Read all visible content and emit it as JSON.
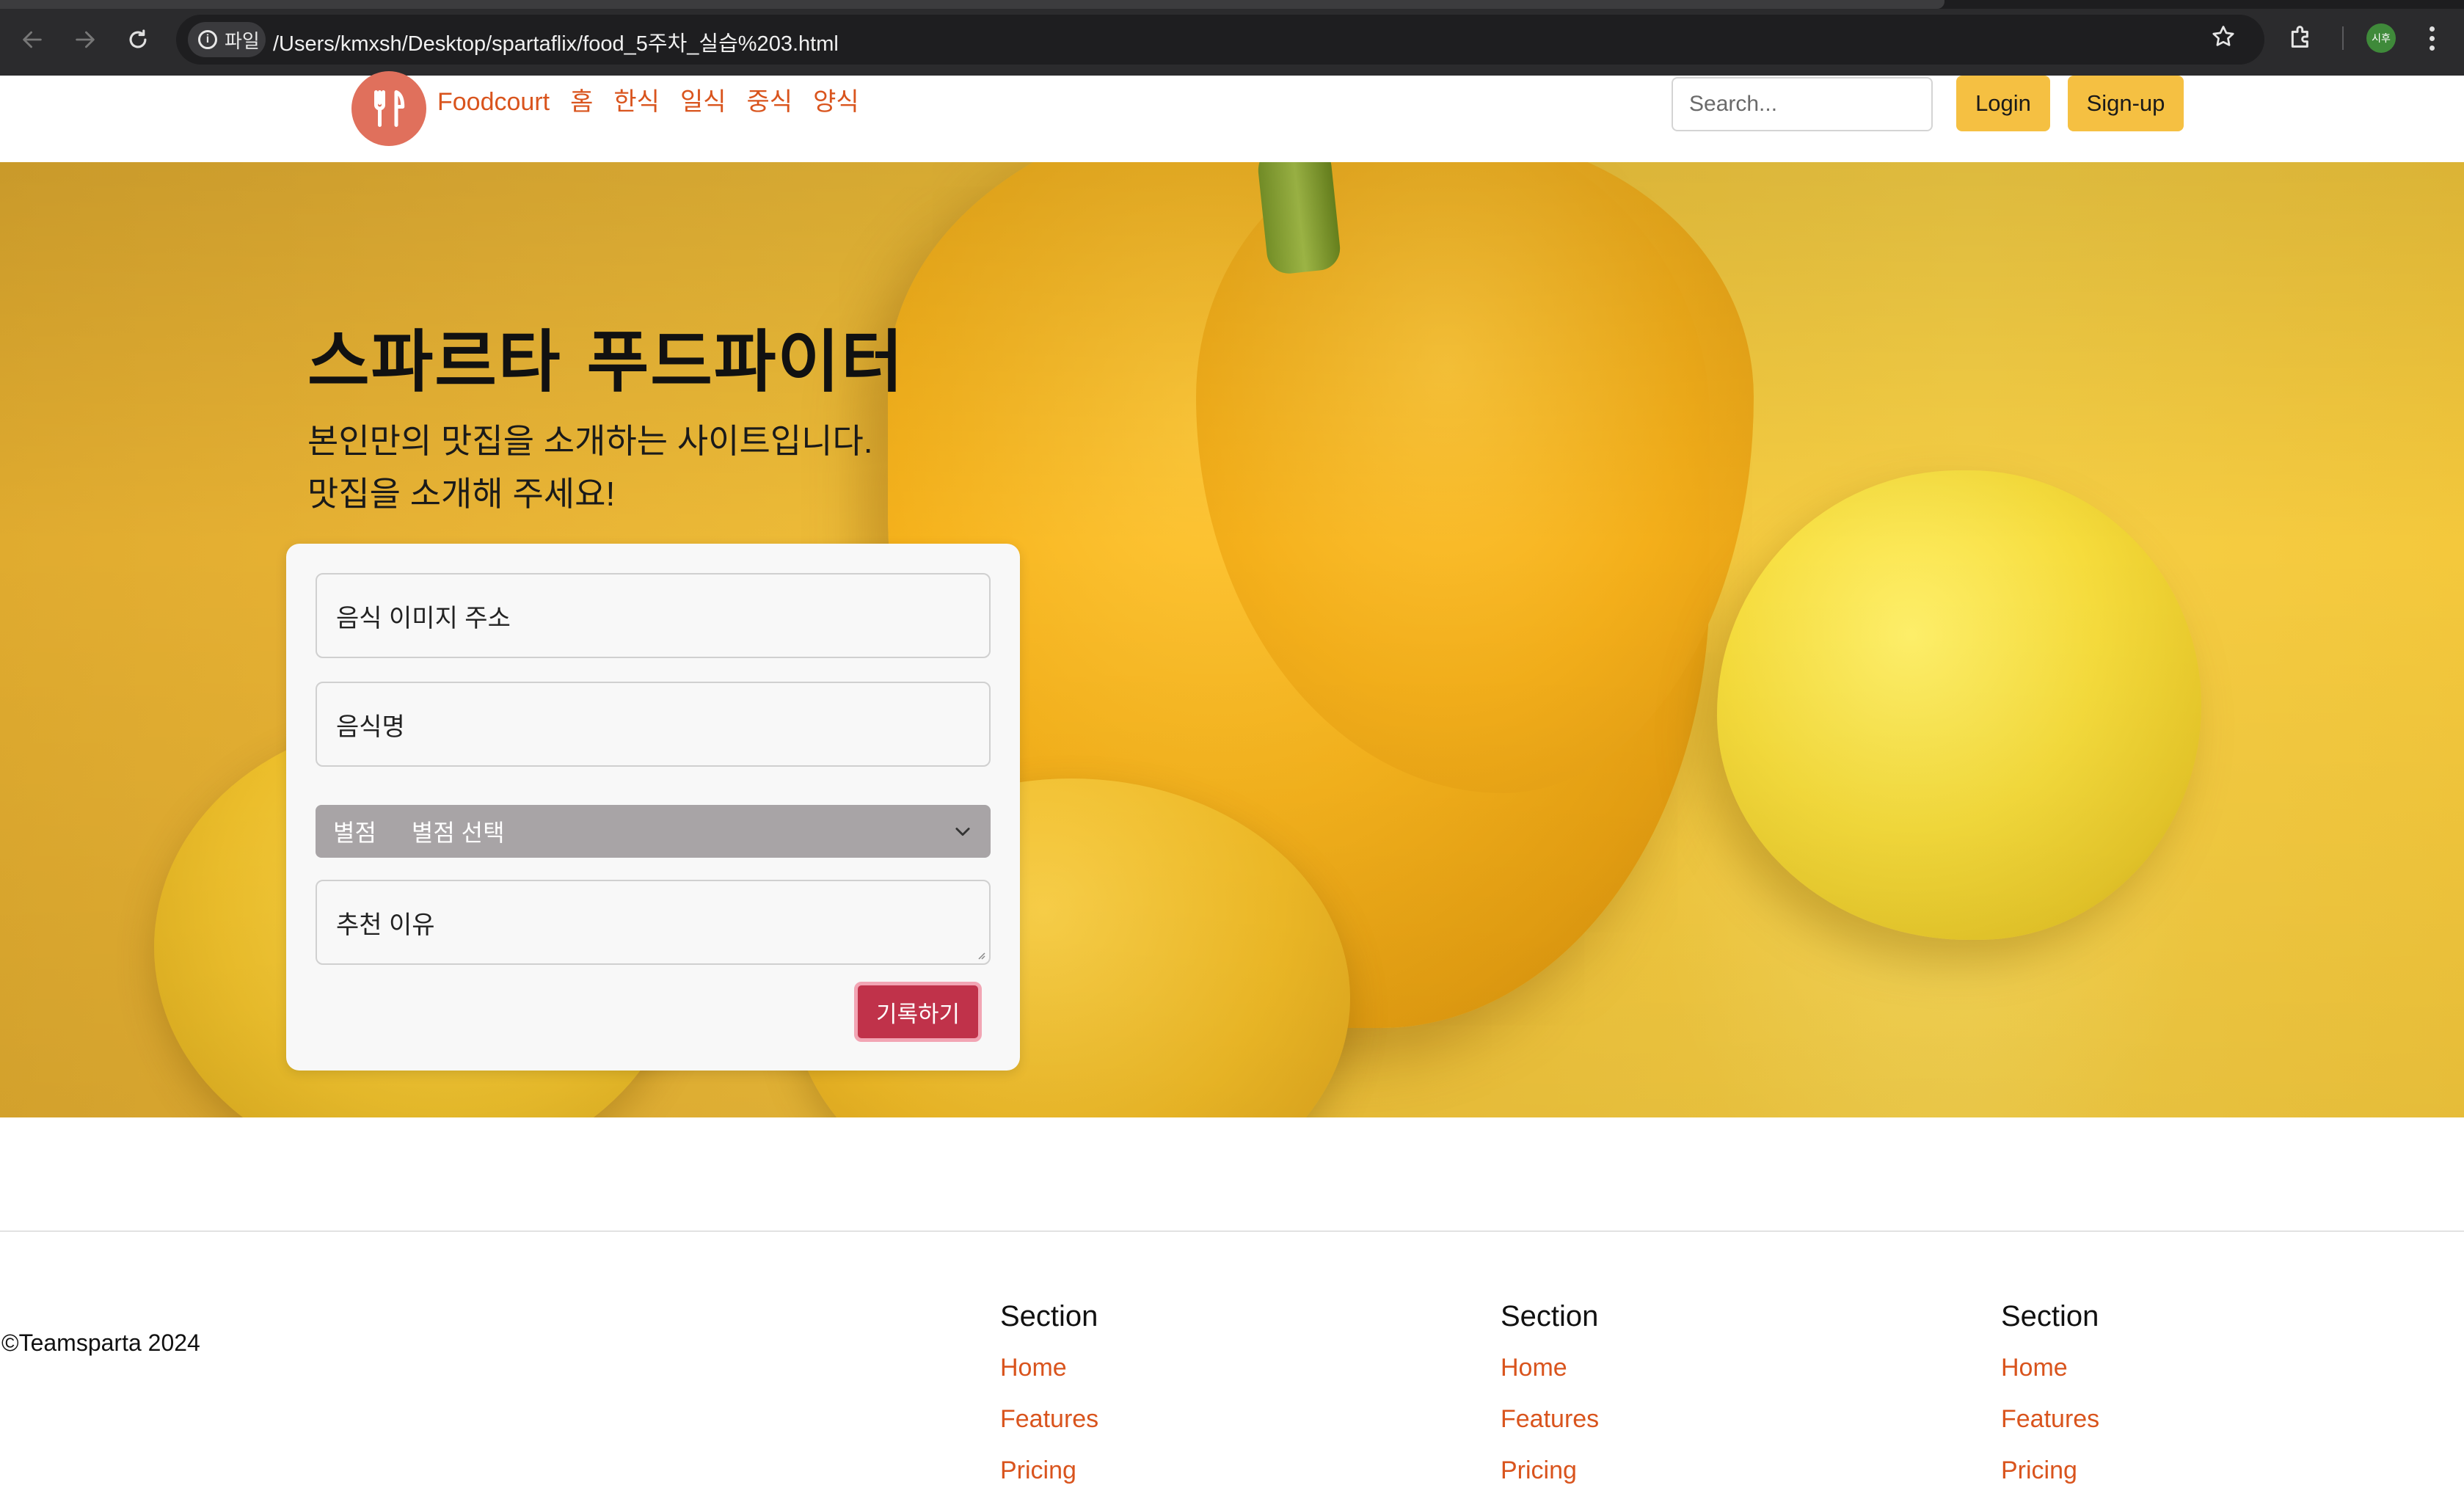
{
  "browser": {
    "chip_label": "파일",
    "url": "/Users/kmxsh/Desktop/spartaflix/food_5주차_실습%203.html",
    "profile_initials": "시후",
    "icons": [
      "back-arrow-icon",
      "forward-arrow-icon",
      "reload-icon",
      "info-icon",
      "star-icon",
      "extensions-icon",
      "kebab-menu-icon"
    ]
  },
  "header": {
    "brand": "Foodcourt",
    "nav": [
      "홈",
      "한식",
      "일식",
      "중식",
      "양식"
    ],
    "search_placeholder": "Search...",
    "login_label": "Login",
    "signup_label": "Sign-up",
    "accent_color": "#d9541d",
    "button_color": "#f5c042"
  },
  "hero": {
    "title": "스파르타 푸드파이터",
    "subtitle_line1": "본인만의 맛집을 소개하는 사이트입니다.",
    "subtitle_line2": "맛집을 소개해 주세요!"
  },
  "form": {
    "image_url_placeholder": "음식 이미지 주소",
    "food_name_placeholder": "음식명",
    "rating_label": "별점",
    "rating_selected": "별점 선택",
    "reason_placeholder": "추천 이유",
    "submit_label": "기록하기",
    "submit_color": "#c0324a"
  },
  "footer": {
    "copyright": "©Teamsparta 2024",
    "columns": [
      {
        "title": "Section",
        "links": [
          "Home",
          "Features",
          "Pricing"
        ]
      },
      {
        "title": "Section",
        "links": [
          "Home",
          "Features",
          "Pricing"
        ]
      },
      {
        "title": "Section",
        "links": [
          "Home",
          "Features",
          "Pricing"
        ]
      }
    ]
  }
}
